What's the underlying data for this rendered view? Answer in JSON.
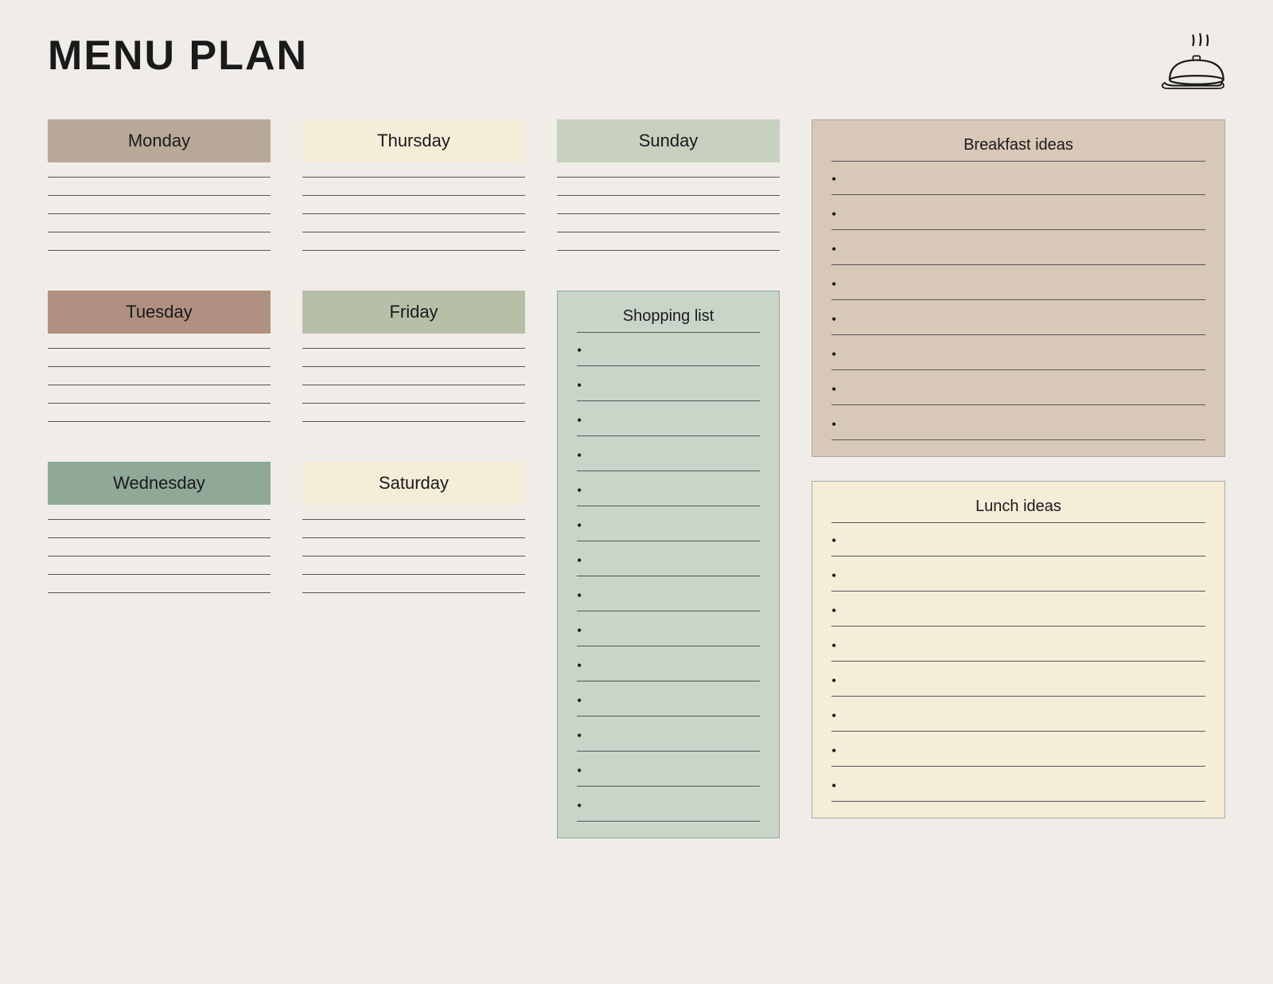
{
  "header": {
    "title": "MENU PLAN"
  },
  "days": {
    "monday": {
      "label": "Monday",
      "color_class": "monday",
      "lines": 5
    },
    "tuesday": {
      "label": "Tuesday",
      "color_class": "tuesday",
      "lines": 5
    },
    "wednesday": {
      "label": "Wednesday",
      "color_class": "wednesday",
      "lines": 5
    },
    "thursday": {
      "label": "Thursday",
      "color_class": "thursday",
      "lines": 5
    },
    "friday": {
      "label": "Friday",
      "color_class": "friday",
      "lines": 5
    },
    "saturday": {
      "label": "Saturday",
      "color_class": "saturday",
      "lines": 5
    },
    "sunday": {
      "label": "Sunday",
      "color_class": "sunday",
      "lines": 5
    }
  },
  "shopping_list": {
    "title": "Shopping list",
    "items": 14
  },
  "breakfast_ideas": {
    "title": "Breakfast ideas",
    "items": 8
  },
  "lunch_ideas": {
    "title": "Lunch ideas",
    "items": 8
  }
}
